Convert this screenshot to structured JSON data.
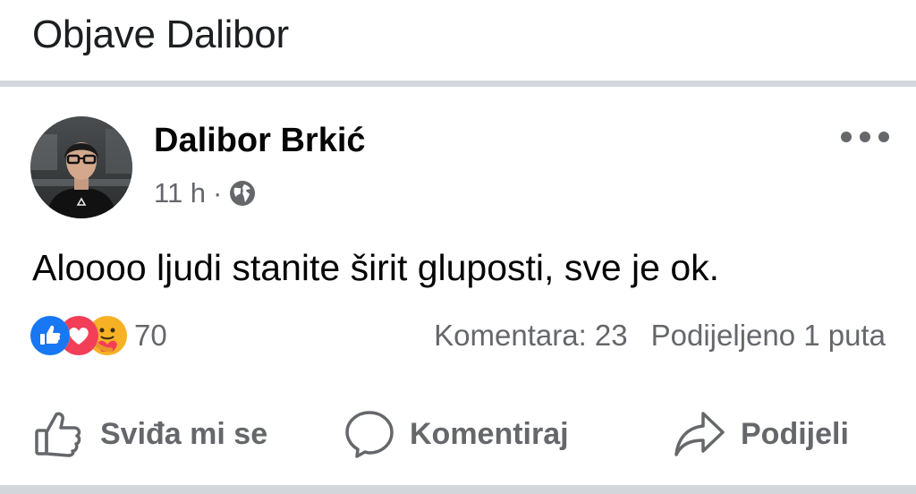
{
  "header": {
    "title": "Objave Dalibor"
  },
  "post": {
    "author": "Dalibor Brkić",
    "time": "11 h",
    "separator": "·",
    "privacy_icon": "globe-icon",
    "text": "Aloooo ljudi stanite širit gluposti, sve je ok.",
    "reactions": {
      "icons": [
        "like-icon",
        "love-icon",
        "care-icon"
      ],
      "count": "70"
    },
    "comments": "Komentara: 23",
    "shares": "Podijeljeno 1 puta"
  },
  "actions": {
    "like": {
      "label": "Sviđa mi se",
      "icon": "thumbs-up-icon"
    },
    "comment": {
      "label": "Komentiraj",
      "icon": "comment-bubble-icon"
    },
    "share": {
      "label": "Podijeli",
      "icon": "share-arrow-icon"
    }
  },
  "colors": {
    "like_blue": "#1877f2",
    "love_red": "#f33e58",
    "care_yellow": "#f7b125",
    "secondary_text": "#65676b",
    "divider": "#d3d6da"
  }
}
